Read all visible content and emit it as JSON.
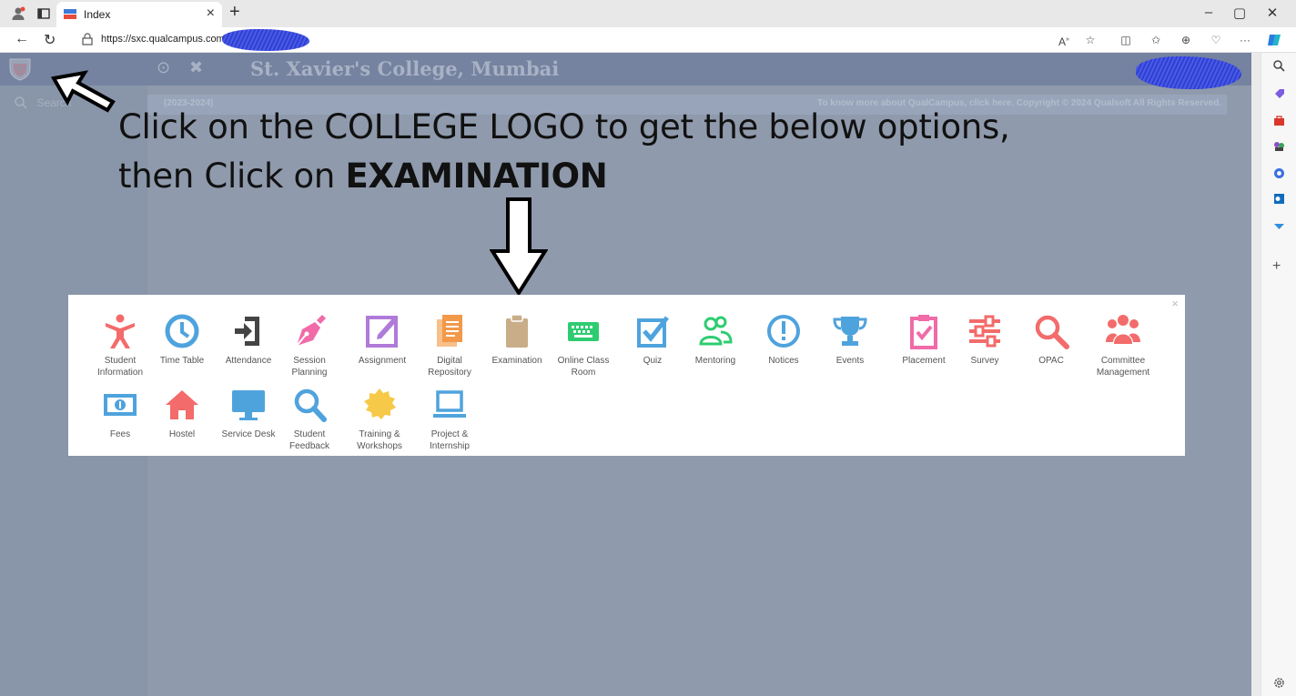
{
  "browser": {
    "tab_title": "Index",
    "tab_close": "×",
    "new_tab": "+",
    "url": "https://sxc.qualcampus.com/",
    "window_buttons": [
      "–",
      "▢",
      "✕"
    ],
    "more": "···"
  },
  "page": {
    "college_name": "St. Xavier's College, Mumbai",
    "search_placeholder": "Search",
    "session_text": "(2023-2024)",
    "footer_text": "To know more about QualCampus, click here. Copyright © 2024 Qualsoft All Rights Reserved."
  },
  "instruction": {
    "line1": "Click on the COLLEGE LOGO to get the below options,",
    "line2_prefix": "then Click on ",
    "line2_bold": "EXAMINATION"
  },
  "modal": {
    "close_label": "×",
    "row1": [
      {
        "label": "Student Information",
        "icon": "person-icon",
        "color": "#f36b6b"
      },
      {
        "label": "Time Table",
        "icon": "clock-icon",
        "color": "#4fa3dd"
      },
      {
        "label": "Attendance",
        "icon": "door-enter-icon",
        "color": "#444444"
      },
      {
        "label": "Session Planning",
        "icon": "pen-icon",
        "color": "#f06ba8"
      },
      {
        "label": "Assignment",
        "icon": "edit-icon",
        "color": "#b07ad9"
      },
      {
        "label": "Digital Repository",
        "icon": "documents-icon",
        "color": "#f2994a"
      },
      {
        "label": "Examination",
        "icon": "clipboard-icon",
        "color": "#c8ad88"
      },
      {
        "label": "Online Class Room",
        "icon": "keyboard-icon",
        "color": "#2ecc71"
      },
      {
        "label": "Quiz",
        "icon": "checkbox-icon",
        "color": "#4fa3dd"
      },
      {
        "label": "Mentoring",
        "icon": "users-outline-icon",
        "color": "#2ecc71"
      },
      {
        "label": "Notices",
        "icon": "exclamation-circle-icon",
        "color": "#4fa3dd"
      },
      {
        "label": "Events",
        "icon": "trophy-icon",
        "color": "#4fa3dd"
      },
      {
        "label": "Placement",
        "icon": "clipboard-check-icon",
        "color": "#f06ba8"
      },
      {
        "label": "Survey",
        "icon": "sliders-icon",
        "color": "#f36b6b"
      },
      {
        "label": "OPAC",
        "icon": "search-icon",
        "color": "#f36b6b"
      },
      {
        "label": "Committee Management",
        "icon": "group-icon",
        "color": "#f36b6b"
      }
    ],
    "row2": [
      {
        "label": "Fees",
        "icon": "money-icon",
        "color": "#4fa3dd"
      },
      {
        "label": "Hostel",
        "icon": "home-icon",
        "color": "#f36b6b"
      },
      {
        "label": "Service Desk",
        "icon": "monitor-icon",
        "color": "#4fa3dd"
      },
      {
        "label": "Student Feedback",
        "icon": "search-icon",
        "color": "#4fa3dd"
      },
      {
        "label": "Training & Workshops",
        "icon": "badge-icon",
        "color": "#f7c948"
      },
      {
        "label": "Project & Internship",
        "icon": "laptop-icon",
        "color": "#4fa3dd"
      }
    ]
  }
}
